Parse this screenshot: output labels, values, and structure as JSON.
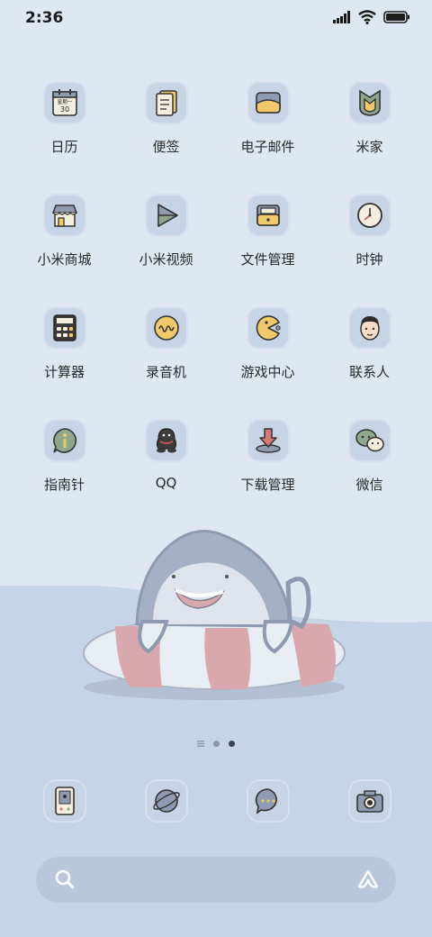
{
  "status": {
    "time": "2:36"
  },
  "apps": [
    [
      {
        "label": "日历",
        "icon": "calendar-icon",
        "cal_weekday": "星期一",
        "cal_day": "30"
      },
      {
        "label": "便签",
        "icon": "notes-icon"
      },
      {
        "label": "电子邮件",
        "icon": "email-icon"
      },
      {
        "label": "米家",
        "icon": "mijia-icon"
      }
    ],
    [
      {
        "label": "小米商城",
        "icon": "store-icon"
      },
      {
        "label": "小米视频",
        "icon": "video-icon"
      },
      {
        "label": "文件管理",
        "icon": "file-manager-icon"
      },
      {
        "label": "时钟",
        "icon": "clock-icon"
      }
    ],
    [
      {
        "label": "计算器",
        "icon": "calculator-icon"
      },
      {
        "label": "录音机",
        "icon": "recorder-icon"
      },
      {
        "label": "游戏中心",
        "icon": "game-center-icon"
      },
      {
        "label": "联系人",
        "icon": "contacts-icon"
      }
    ],
    [
      {
        "label": "指南针",
        "icon": "compass-icon"
      },
      {
        "label": "QQ",
        "icon": "qq-icon"
      },
      {
        "label": "下载管理",
        "icon": "download-icon"
      },
      {
        "label": "微信",
        "icon": "wechat-icon"
      }
    ]
  ],
  "dock": [
    {
      "icon": "phone-icon"
    },
    {
      "icon": "browser-icon"
    },
    {
      "icon": "messages-icon"
    },
    {
      "icon": "camera-icon"
    }
  ],
  "pager": {
    "pages": 2,
    "active": 2
  },
  "colors": {
    "background": "#dfe7f3",
    "tile": "#c7d4e6",
    "wave": "#c6d4e7",
    "accent_yellow": "#f0c96a",
    "accent_pink": "#d8a8ae"
  }
}
